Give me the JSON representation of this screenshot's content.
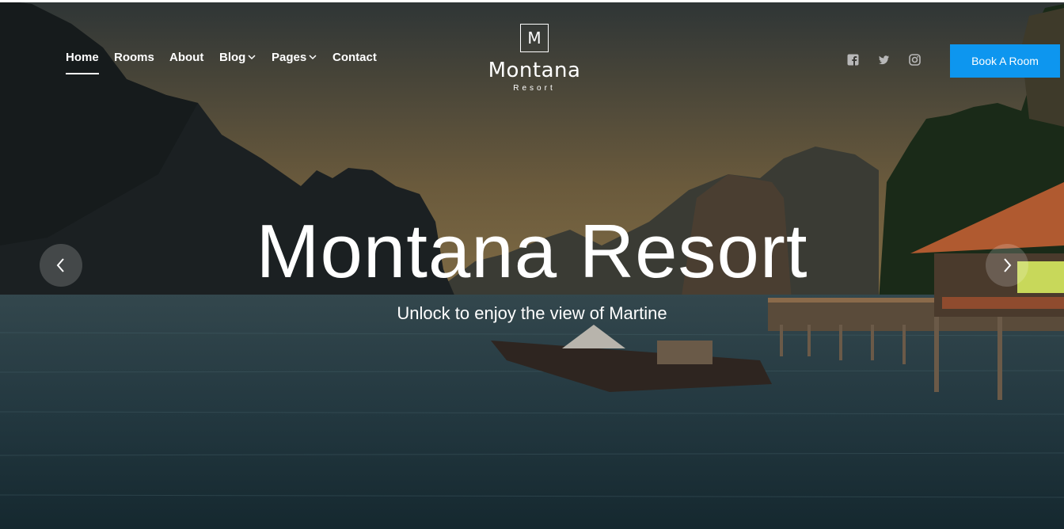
{
  "nav": {
    "items": [
      {
        "label": "Home",
        "active": true,
        "has_dropdown": false
      },
      {
        "label": "Rooms",
        "active": false,
        "has_dropdown": false
      },
      {
        "label": "About",
        "active": false,
        "has_dropdown": false
      },
      {
        "label": "Blog",
        "active": false,
        "has_dropdown": true
      },
      {
        "label": "Pages",
        "active": false,
        "has_dropdown": true
      },
      {
        "label": "Contact",
        "active": false,
        "has_dropdown": false
      }
    ]
  },
  "logo": {
    "letter": "M",
    "name": "Montana",
    "subtitle": "Resort"
  },
  "social": {
    "icons": [
      "facebook-icon",
      "twitter-icon",
      "instagram-icon"
    ],
    "color": "#b8b8b8"
  },
  "book_button": {
    "label": "Book A Room",
    "color": "#0d96ef"
  },
  "hero": {
    "title": "Montana Resort",
    "subtitle": "Unlock to enjoy the view of Martine"
  },
  "slider": {
    "prev_icon": "chevron-left-icon",
    "next_icon": "chevron-right-icon"
  }
}
